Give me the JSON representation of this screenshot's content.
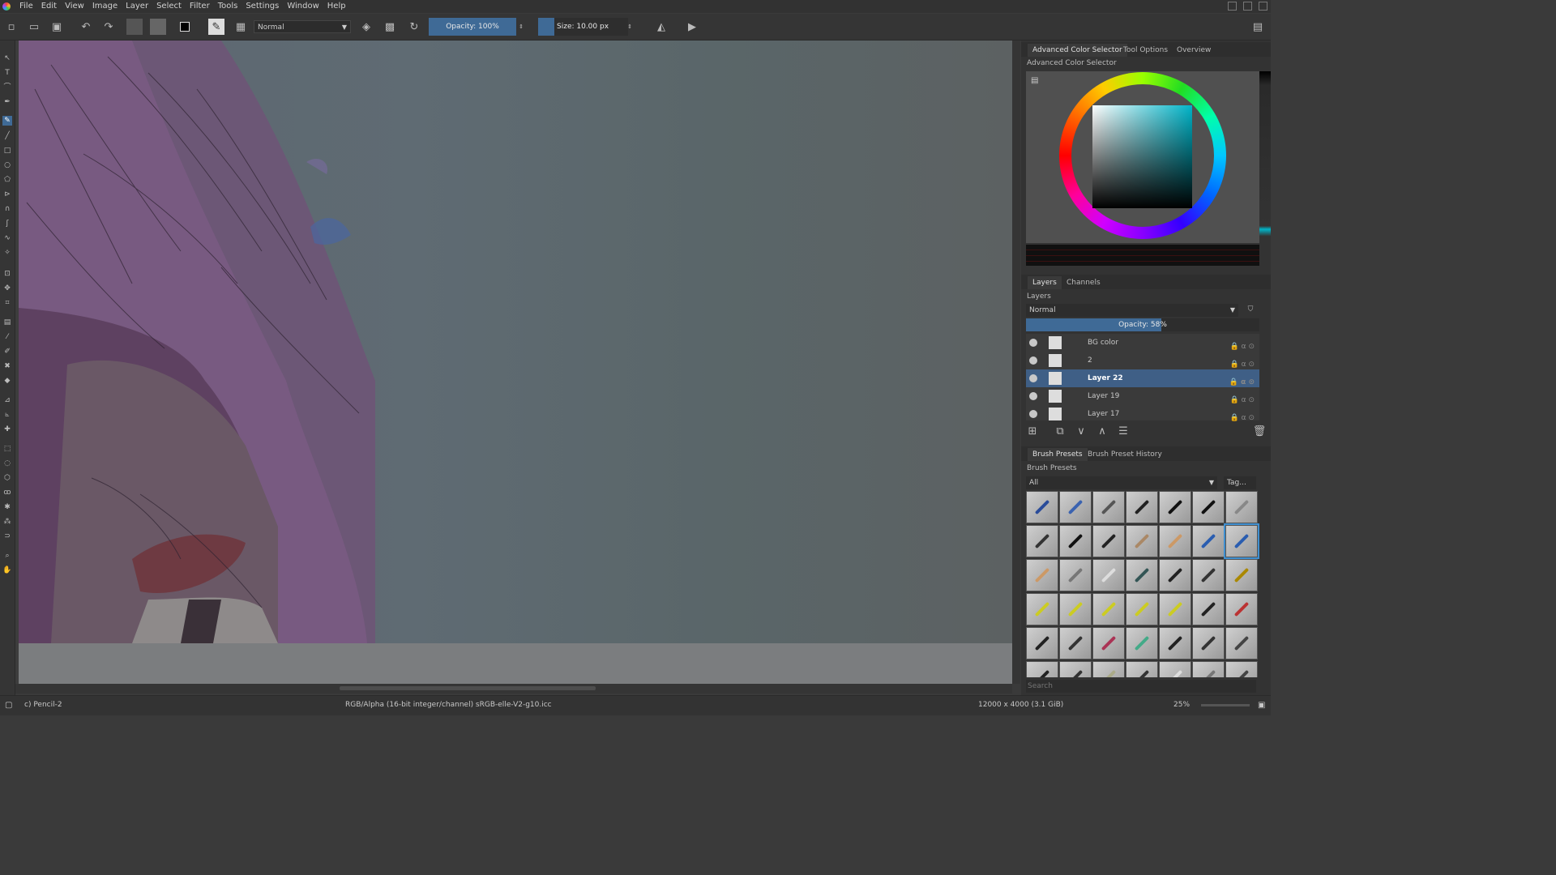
{
  "menu": [
    "File",
    "Edit",
    "View",
    "Image",
    "Layer",
    "Select",
    "Filter",
    "Tools",
    "Settings",
    "Window",
    "Help"
  ],
  "toolbar": {
    "blend_mode": "Normal",
    "opacity_label": "Opacity:  100%",
    "size_label": "Size:  10.00 px"
  },
  "dock": {
    "top_tabs": [
      "Advanced Color Selector",
      "Tool Options",
      "Overview"
    ],
    "color_panel_title": "Advanced Color Selector",
    "accent": "#3f6a96",
    "layers_tabs": [
      "Layers",
      "Channels"
    ],
    "layers_title": "Layers",
    "layer_blend": "Normal",
    "layer_opacity_label": "Opacity:  58%",
    "layer_opacity": 0.58,
    "layers": [
      {
        "name": "BG color",
        "selected": false
      },
      {
        "name": "2",
        "selected": false
      },
      {
        "name": "Layer 22",
        "selected": true
      },
      {
        "name": "Layer 19",
        "selected": false
      },
      {
        "name": "Layer 17",
        "selected": false
      }
    ],
    "brush_tabs": [
      "Brush Presets",
      "Brush Preset History"
    ],
    "brush_title": "Brush Presets",
    "brush_filter": "All",
    "brush_tag": "Tag...",
    "brush_search_placeholder": "Search"
  },
  "status": {
    "brush_name": "c) Pencil-2",
    "color_space": "RGB/Alpha (16-bit integer/channel)  sRGB-elle-V2-g10.icc",
    "image_size": "12000 x 4000 (3.1 GiB)",
    "zoom": "25%"
  }
}
